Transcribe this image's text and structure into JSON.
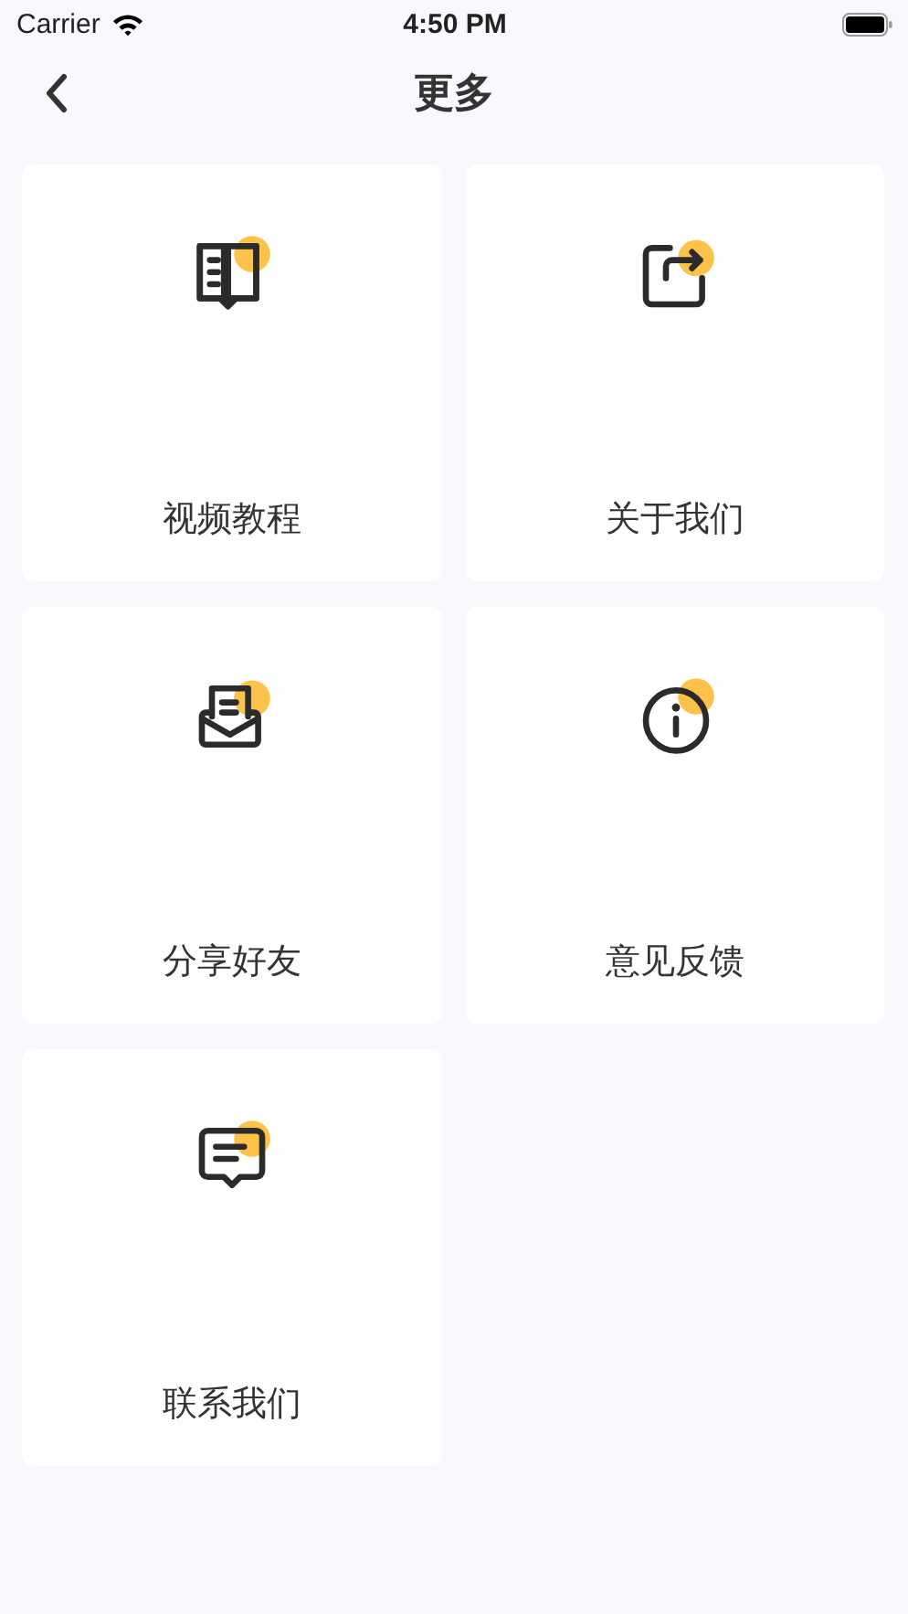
{
  "status_bar": {
    "carrier": "Carrier",
    "time": "4:50 PM"
  },
  "nav": {
    "title": "更多"
  },
  "items": [
    {
      "label": "视频教程",
      "kind": "book"
    },
    {
      "label": "关于我们",
      "kind": "share"
    },
    {
      "label": "分享好友",
      "kind": "mail"
    },
    {
      "label": "意见反馈",
      "kind": "info"
    },
    {
      "label": "联系我们",
      "kind": "message"
    }
  ]
}
